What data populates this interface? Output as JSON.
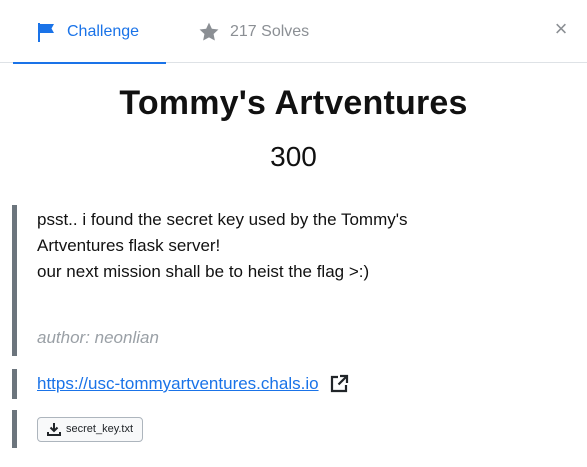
{
  "tabs": {
    "challenge_label": "Challenge",
    "solves_label": "217 Solves"
  },
  "close_label": "×",
  "challenge": {
    "title": "Tommy's Artventures",
    "points": "300",
    "description": [
      "psst.. i found the secret key used by the Tommy's",
      "Artventures flask server!",
      "our next mission shall be to heist the flag >:)"
    ],
    "author": "author: neonlian",
    "url": "https://usc-tommyartventures.chals.io",
    "file_name": "secret_key.txt"
  },
  "icons": {
    "challenge_tab": "flag-icon",
    "solves_tab": "star-icon",
    "close": "close-icon",
    "link": "external-link-icon",
    "file": "download-icon"
  },
  "colors": {
    "accent": "#1a73e8",
    "muted": "#8b8f94",
    "quote_bar": "#6c757d"
  }
}
